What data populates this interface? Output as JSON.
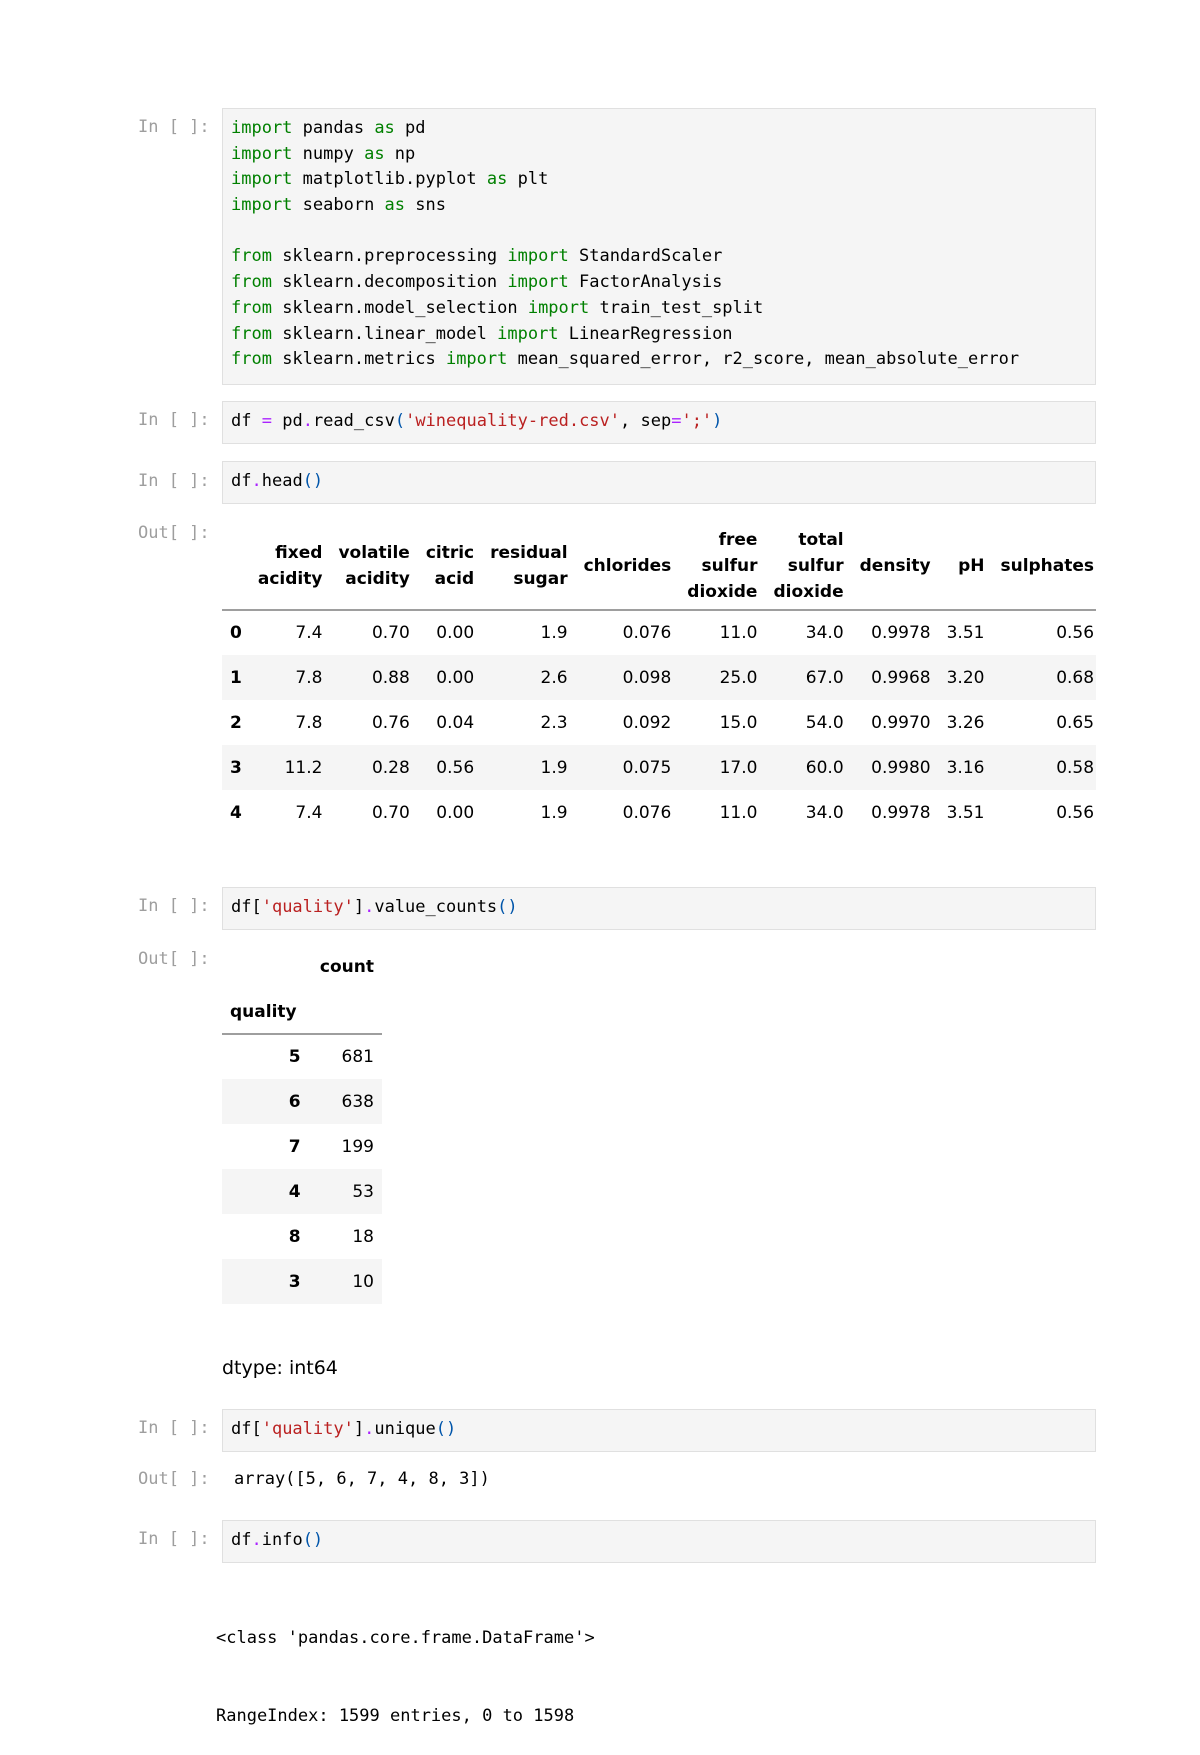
{
  "cells": [
    {
      "prompt": "In [ ]:",
      "lines": [
        [
          {
            "t": "import",
            "c": "kw"
          },
          {
            "t": " pandas "
          },
          {
            "t": "as",
            "c": "kw"
          },
          {
            "t": " pd"
          }
        ],
        [
          {
            "t": "import",
            "c": "kw"
          },
          {
            "t": " numpy "
          },
          {
            "t": "as",
            "c": "kw"
          },
          {
            "t": " np"
          }
        ],
        [
          {
            "t": "import",
            "c": "kw"
          },
          {
            "t": " matplotlib.pyplot "
          },
          {
            "t": "as",
            "c": "kw"
          },
          {
            "t": " plt"
          }
        ],
        [
          {
            "t": "import",
            "c": "kw"
          },
          {
            "t": " seaborn "
          },
          {
            "t": "as",
            "c": "kw"
          },
          {
            "t": " sns"
          }
        ],
        [],
        [
          {
            "t": "from",
            "c": "kw"
          },
          {
            "t": " sklearn.preprocessing "
          },
          {
            "t": "import",
            "c": "kw"
          },
          {
            "t": " StandardScaler"
          }
        ],
        [
          {
            "t": "from",
            "c": "kw"
          },
          {
            "t": " sklearn.decomposition "
          },
          {
            "t": "import",
            "c": "kw"
          },
          {
            "t": " FactorAnalysis"
          }
        ],
        [
          {
            "t": "from",
            "c": "kw"
          },
          {
            "t": " sklearn.model_selection "
          },
          {
            "t": "import",
            "c": "kw"
          },
          {
            "t": " train_test_split"
          }
        ],
        [
          {
            "t": "from",
            "c": "kw"
          },
          {
            "t": " sklearn.linear_model "
          },
          {
            "t": "import",
            "c": "kw"
          },
          {
            "t": " LinearRegression"
          }
        ],
        [
          {
            "t": "from",
            "c": "kw"
          },
          {
            "t": " sklearn.metrics "
          },
          {
            "t": "import",
            "c": "kw"
          },
          {
            "t": " mean_squared_error, r2_score, mean_absolute_error"
          }
        ]
      ]
    },
    {
      "prompt": "In [ ]:",
      "lines": [
        [
          {
            "t": "df "
          },
          {
            "t": "=",
            "c": "op"
          },
          {
            "t": " pd"
          },
          {
            "t": ".",
            "c": "op"
          },
          {
            "t": "read_csv"
          },
          {
            "t": "(",
            "c": "par"
          },
          {
            "t": "'winequality-red.csv'",
            "c": "str"
          },
          {
            "t": ", sep"
          },
          {
            "t": "=",
            "c": "op"
          },
          {
            "t": "';'",
            "c": "str"
          },
          {
            "t": ")",
            "c": "par"
          }
        ]
      ]
    },
    {
      "prompt": "In [ ]:",
      "lines": [
        [
          {
            "t": "df"
          },
          {
            "t": ".",
            "c": "op"
          },
          {
            "t": "head"
          },
          {
            "t": "()",
            "c": "par"
          }
        ]
      ]
    },
    {
      "prompt": "In [ ]:",
      "lines": [
        [
          {
            "t": "df["
          },
          {
            "t": "'quality'",
            "c": "str"
          },
          {
            "t": "]"
          },
          {
            "t": ".",
            "c": "op"
          },
          {
            "t": "value_counts"
          },
          {
            "t": "()",
            "c": "par"
          }
        ]
      ]
    },
    {
      "prompt": "In [ ]:",
      "lines": [
        [
          {
            "t": "df["
          },
          {
            "t": "'quality'",
            "c": "str"
          },
          {
            "t": "]"
          },
          {
            "t": ".",
            "c": "op"
          },
          {
            "t": "unique"
          },
          {
            "t": "()",
            "c": "par"
          }
        ]
      ]
    },
    {
      "prompt": "In [ ]:",
      "lines": [
        [
          {
            "t": "df"
          },
          {
            "t": ".",
            "c": "op"
          },
          {
            "t": "info"
          },
          {
            "t": "()",
            "c": "par"
          }
        ]
      ]
    }
  ],
  "out_prompt": "Out[ ]:",
  "head_table": {
    "columns": [
      [
        "fixed",
        "acidity"
      ],
      [
        "volatile",
        "acidity"
      ],
      [
        "citric",
        "acid"
      ],
      [
        "residual",
        "sugar"
      ],
      [
        "chlorides"
      ],
      [
        "free",
        "sulfur",
        "dioxide"
      ],
      [
        "total",
        "sulfur",
        "dioxide"
      ],
      [
        "density"
      ],
      [
        "pH"
      ],
      [
        "sulphates"
      ]
    ],
    "rows": [
      {
        "index": "0",
        "values": [
          "7.4",
          "0.70",
          "0.00",
          "1.9",
          "0.076",
          "11.0",
          "34.0",
          "0.9978",
          "3.51",
          "0.56"
        ]
      },
      {
        "index": "1",
        "values": [
          "7.8",
          "0.88",
          "0.00",
          "2.6",
          "0.098",
          "25.0",
          "67.0",
          "0.9968",
          "3.20",
          "0.68"
        ]
      },
      {
        "index": "2",
        "values": [
          "7.8",
          "0.76",
          "0.04",
          "2.3",
          "0.092",
          "15.0",
          "54.0",
          "0.9970",
          "3.26",
          "0.65"
        ]
      },
      {
        "index": "3",
        "values": [
          "11.2",
          "0.28",
          "0.56",
          "1.9",
          "0.075",
          "17.0",
          "60.0",
          "0.9980",
          "3.16",
          "0.58"
        ]
      },
      {
        "index": "4",
        "values": [
          "7.4",
          "0.70",
          "0.00",
          "1.9",
          "0.076",
          "11.0",
          "34.0",
          "0.9978",
          "3.51",
          "0.56"
        ]
      }
    ]
  },
  "counts_table": {
    "column": "count",
    "index_name": "quality",
    "rows": [
      {
        "index": "5",
        "value": "681"
      },
      {
        "index": "6",
        "value": "638"
      },
      {
        "index": "7",
        "value": "199"
      },
      {
        "index": "4",
        "value": "53"
      },
      {
        "index": "8",
        "value": "18"
      },
      {
        "index": "3",
        "value": "10"
      }
    ],
    "dtype": "dtype: int64"
  },
  "unique_output": "array([5, 6, 7, 4, 8, 3])",
  "info_output": [
    "<class 'pandas.core.frame.DataFrame'>",
    "RangeIndex: 1599 entries, 0 to 1598"
  ]
}
